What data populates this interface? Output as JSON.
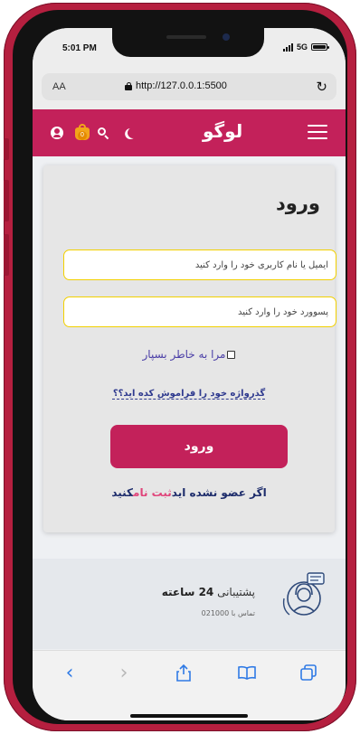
{
  "status_bar": {
    "time": "5:01 PM",
    "network": "5G"
  },
  "browser": {
    "aa_label": "AA",
    "url": "http://127.0.0.1:5500"
  },
  "header": {
    "logo": "لوگو",
    "cart_count": "0"
  },
  "login": {
    "title": "ورود",
    "email_placeholder": "ایمیل یا نام کاربری خود را وارد کنید",
    "password_placeholder": "پسوورد خود را وارد کنید",
    "remember_label": "مرا به خاطر بسپار",
    "forgot_link": "گذرواژه خود را فراموش کده اید؟؟",
    "submit_label": "ورود",
    "signup_prefix": "اگر عضو نشده اید",
    "signup_link": "ثبت نام",
    "signup_suffix": "کنید"
  },
  "support": {
    "title_prefix": "پشتیبانی",
    "title_bold": "24 ساعته",
    "contact": "تماس با 021000"
  },
  "colors": {
    "brand": "#c3215a",
    "field_border": "#f2d000",
    "link": "#2f3a8f",
    "accent_pink": "#e0447a"
  }
}
